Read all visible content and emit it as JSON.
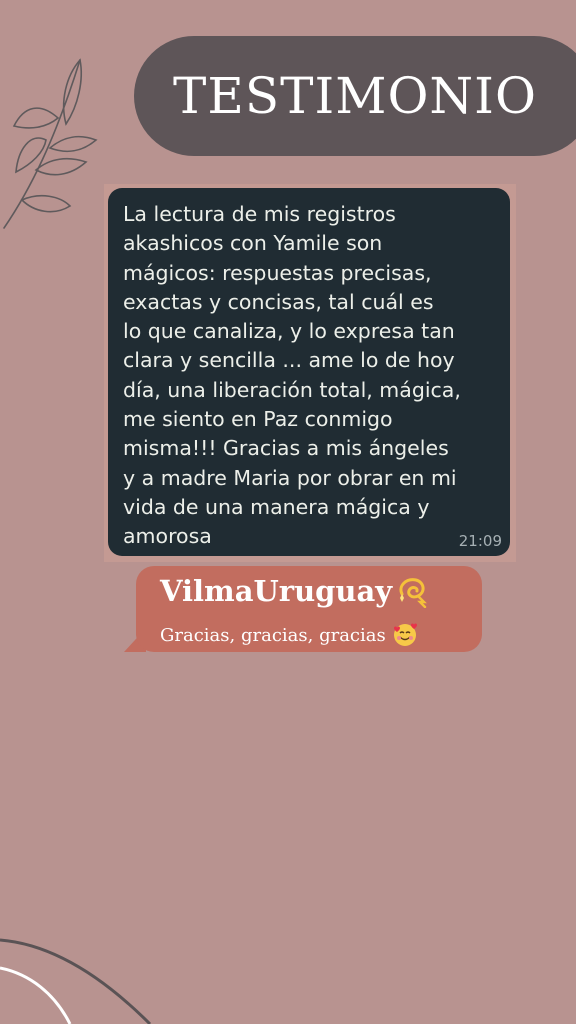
{
  "header": {
    "title": "TESTIMONIO"
  },
  "message": {
    "text": "La lectura de mis registros\nakashicos con Yamile son\nmágicos: respuestas precisas,\nexactas y concisas, tal cuál es\nlo que canaliza, y lo expresa tan\nclara y sencilla ... ame lo de hoy\ndía,  una liberación total, mágica,\nme siento en Paz conmigo\nmisma!!! Gracias a mis ángeles\ny a madre Maria por obrar en mi\nvida de una manera mágica y\namorosa",
    "time": "21:09"
  },
  "reply": {
    "name": "VilmaUruguay",
    "name_icon": "dizzy-emoji-icon",
    "text": "Gracias, gracias, gracias",
    "text_icon": "smiling-face-with-hearts-emoji-icon"
  },
  "colors": {
    "background": "#b89390",
    "header_pill": "#5e5558",
    "chat_bubble": "#202c33",
    "reply_bubble": "#c26d5f"
  }
}
